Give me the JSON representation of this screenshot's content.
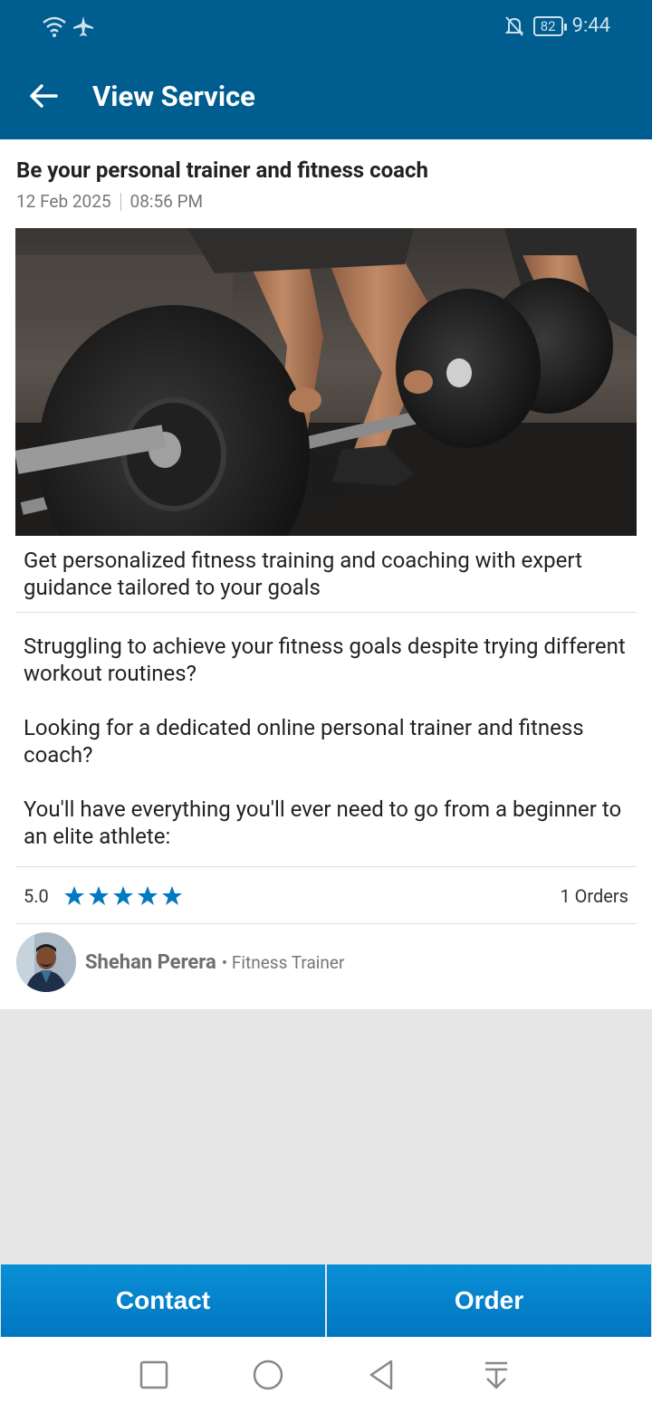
{
  "status_bar": {
    "time": "9:44",
    "battery": "82",
    "icons": [
      "wifi-icon",
      "airplane-icon",
      "notifications-off-icon",
      "battery-icon"
    ]
  },
  "appbar": {
    "title": "View Service",
    "back_icon": "arrow-left-icon"
  },
  "service": {
    "title": "Be your personal trainer and fitness coach",
    "date": "12 Feb 2025",
    "time": "08:56 PM",
    "summary": "Get personalized fitness training and coaching with expert guidance tailored to your goals",
    "description": [
      "Struggling to achieve your fitness goals despite trying different workout routines?",
      "Looking for a dedicated online personal trainer and fitness coach?",
      "You'll have everything you'll ever need to go from a beginner to an elite athlete:"
    ],
    "rating": "5.0",
    "stars": 5,
    "orders": "1 Orders"
  },
  "seller": {
    "name": "Shehan Perera",
    "role": "• Fitness Trainer"
  },
  "actions": {
    "contact": "Contact",
    "order": "Order"
  },
  "colors": {
    "primary": "#005d8f",
    "button": "#0085cc",
    "star": "#0079c2"
  },
  "nav": [
    "square-icon",
    "circle-icon",
    "triangle-back-icon",
    "download-icon"
  ]
}
